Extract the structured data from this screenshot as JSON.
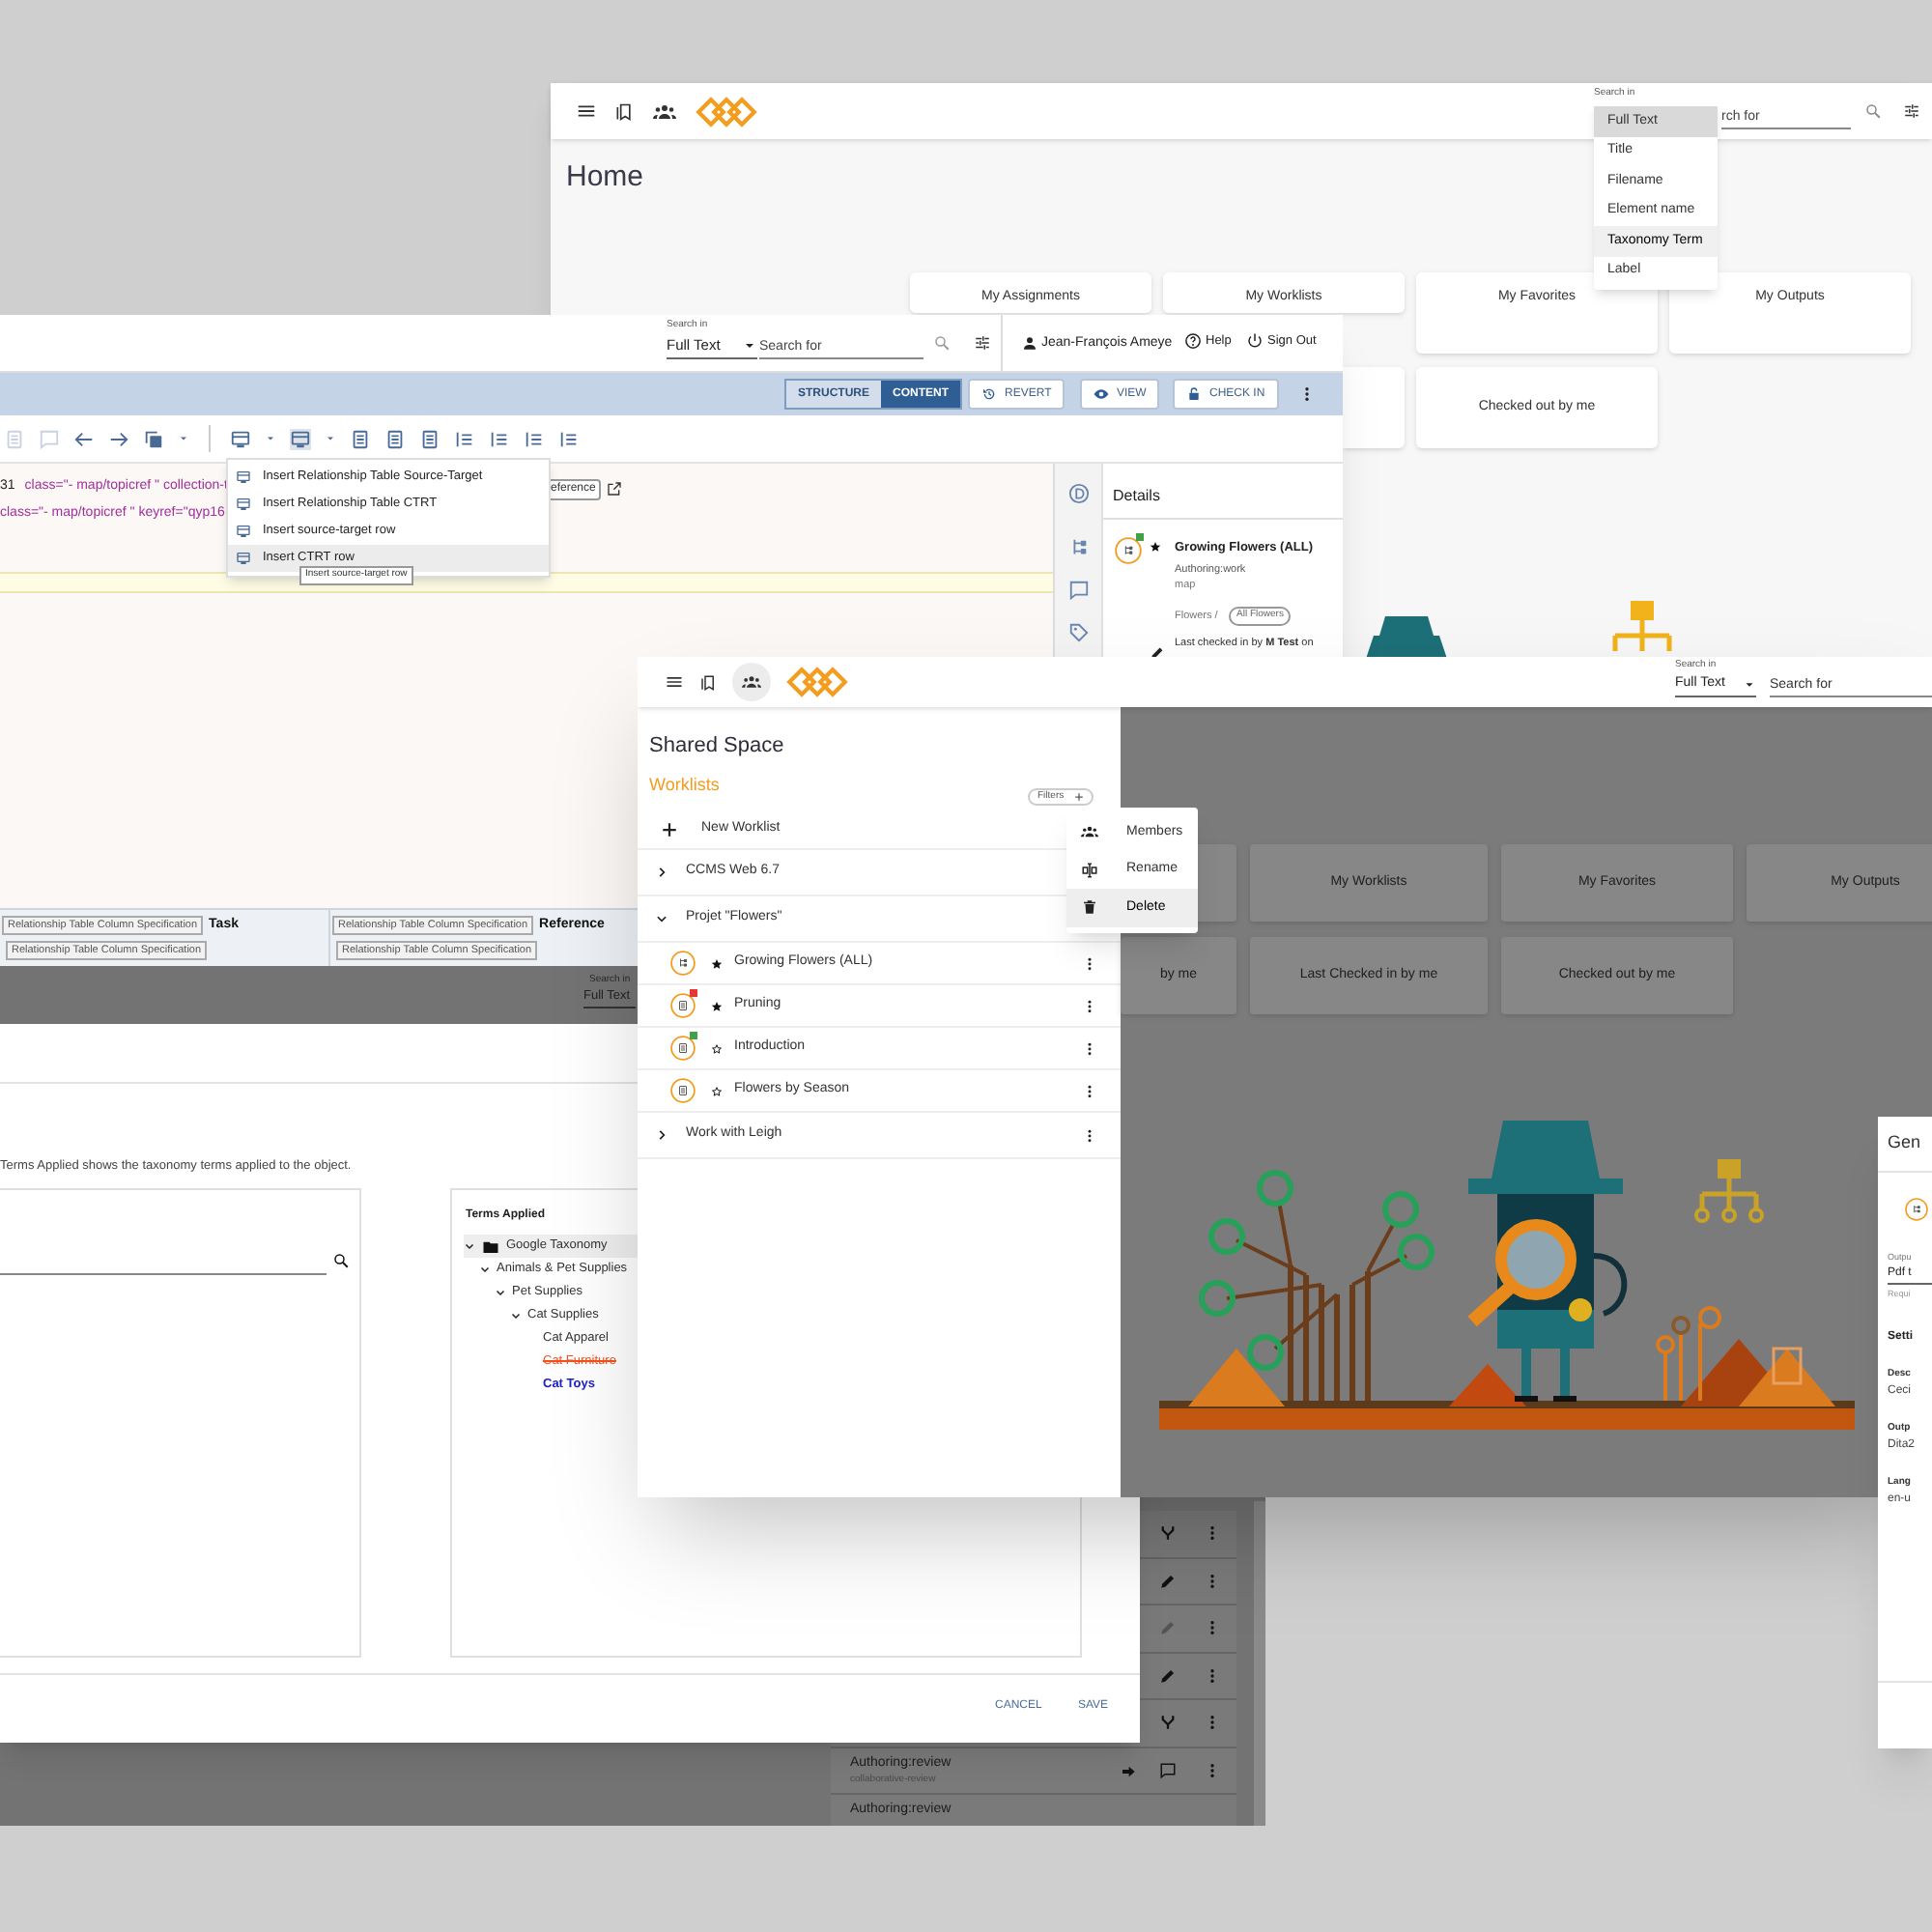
{
  "home_window": {
    "search_label": "Search in",
    "search_partial": "rch for",
    "search_menu": [
      {
        "label": "Full Text",
        "selected": true,
        "hovered": false
      },
      {
        "label": "Title",
        "selected": false,
        "hovered": false
      },
      {
        "label": "Filename",
        "selected": false,
        "hovered": false
      },
      {
        "label": "Element name",
        "selected": false,
        "hovered": false
      },
      {
        "label": "Taxonomy Term",
        "selected": false,
        "hovered": true
      },
      {
        "label": "Label",
        "selected": false,
        "hovered": false
      }
    ],
    "title": "Home",
    "tiles": [
      "My Assignments",
      "My Worklists",
      "My Favorites",
      "My Outputs",
      "Checked out by me"
    ]
  },
  "editor_window": {
    "search_label": "Search in",
    "search_scope": "Full Text",
    "search_placeholder": "Search for",
    "user": "Jean-François Ameye",
    "help": "Help",
    "sign_out": "Sign Out",
    "view_toggle": [
      {
        "label": "STRUCTURE",
        "selected": false
      },
      {
        "label": "CONTENT",
        "selected": true
      }
    ],
    "actions": [
      {
        "label": "REVERT",
        "kind": "revert"
      },
      {
        "label": "VIEW",
        "kind": "view"
      },
      {
        "label": "CHECK IN",
        "kind": "check-in"
      }
    ],
    "code_lines": [
      {
        "number": "31",
        "code": "class=\"- map/topicref \" collection-t"
      },
      {
        "code": "class=\"- map/topicref \" keyref=\"qyp16"
      }
    ],
    "reference_tag": "eference",
    "insert_menu": [
      {
        "label": "Insert Relationship Table Source-Target",
        "highlighted": false
      },
      {
        "label": "Insert Relationship Table CTRT",
        "highlighted": false
      },
      {
        "label": "Insert source-target row",
        "highlighted": false
      },
      {
        "label": "Insert CTRT row",
        "highlighted": true
      }
    ],
    "tooltip": "Insert source-target row",
    "details": {
      "title": "Details",
      "item": {
        "title": "Growing Flowers (ALL)",
        "starred": true,
        "color": "#43a047",
        "subtitle": "Authoring:work",
        "type": "map",
        "path": "Flowers /",
        "tag": "All Flowers",
        "last_checked": "Last checked in by **M Test** on"
      }
    },
    "columns": [
      {
        "start_tag": "Relationship Table Column Specification",
        "label": "Task",
        "end_tag": "Relationship Table Column Specification"
      },
      {
        "start_tag": "Relationship Table Column Specification",
        "label": "Reference",
        "end_tag": "Relationship Table Column Specification"
      }
    ]
  },
  "taxonomy_window": {
    "search_label": "Search in",
    "search_scope": "Full Text",
    "description": "Terms Applied shows the taxonomy terms applied to the object.",
    "terms_title": "Terms Applied",
    "terms": [
      {
        "label": "Google Taxonomy",
        "kind": "folder",
        "expanded": true,
        "children": [
          {
            "label": "Animals & Pet Supplies",
            "expanded": true,
            "children": [
              {
                "label": "Pet Supplies",
                "expanded": true,
                "children": [
                  {
                    "label": "Cat Supplies",
                    "expanded": true,
                    "children": [
                      {
                        "label": "Cat Apparel",
                        "kind": "applied"
                      },
                      {
                        "label": "Cat Furniture",
                        "kind": "removed"
                      },
                      {
                        "label": "Cat Toys",
                        "kind": "added"
                      }
                    ]
                  }
                ]
              }
            ]
          }
        ]
      }
    ],
    "buttons": [
      "CANCEL",
      "SAVE"
    ],
    "side_rows": [
      {
        "kind": "branch"
      },
      {
        "kind": "edit",
        "disabled": false
      },
      {
        "kind": "edit",
        "disabled": true
      },
      {
        "kind": "edit",
        "disabled": false
      },
      {
        "kind": "branch"
      },
      {
        "kind": "comment",
        "title": "Authoring:review",
        "subtitle": "collaborative-review"
      },
      {
        "title": "Authoring:review"
      }
    ]
  },
  "shared_window": {
    "search_label": "Search in",
    "search_scope": "Full Text",
    "search_placeholder": "Search for",
    "title": "Shared Space",
    "section": "Worklists",
    "filters": "Filters",
    "new_worklist": "New Worklist",
    "worklists": [
      {
        "label": "CCMS Web 6.7",
        "expanded": false
      },
      {
        "label": "Projet \"Flowers\"",
        "expanded": true,
        "children": [
          {
            "label": "Growing Flowers (ALL)",
            "kind": "map",
            "starred": true
          },
          {
            "label": "Pruning",
            "kind": "topic",
            "starred": true,
            "color": "#e53935"
          },
          {
            "label": "Introduction",
            "kind": "topic",
            "starred": false,
            "color": "#43a047"
          },
          {
            "label": "Flowers by Season",
            "kind": "topic",
            "starred": false
          }
        ]
      },
      {
        "label": "Work with Leigh",
        "expanded": false
      }
    ],
    "context_menu": [
      {
        "label": "Members",
        "kind": "members",
        "hovered": false
      },
      {
        "label": "Rename",
        "kind": "rename",
        "hovered": false
      },
      {
        "label": "Delete",
        "kind": "delete",
        "hovered": true
      }
    ],
    "tiles": [
      "My Worklists",
      "My Favorites",
      "My Outputs",
      "by me",
      "Last Checked in by me",
      "Checked out by me"
    ]
  },
  "output_window": {
    "title": "Gen",
    "field_label": "Outpu",
    "field_value": "Pdf t",
    "field_hint": "Requi",
    "section": "Setti",
    "properties": [
      {
        "label": "Desc",
        "value": "Ceci"
      },
      {
        "label": "Outp",
        "value": "Dita2"
      },
      {
        "label": "Lang",
        "value": "en-u"
      }
    ]
  }
}
